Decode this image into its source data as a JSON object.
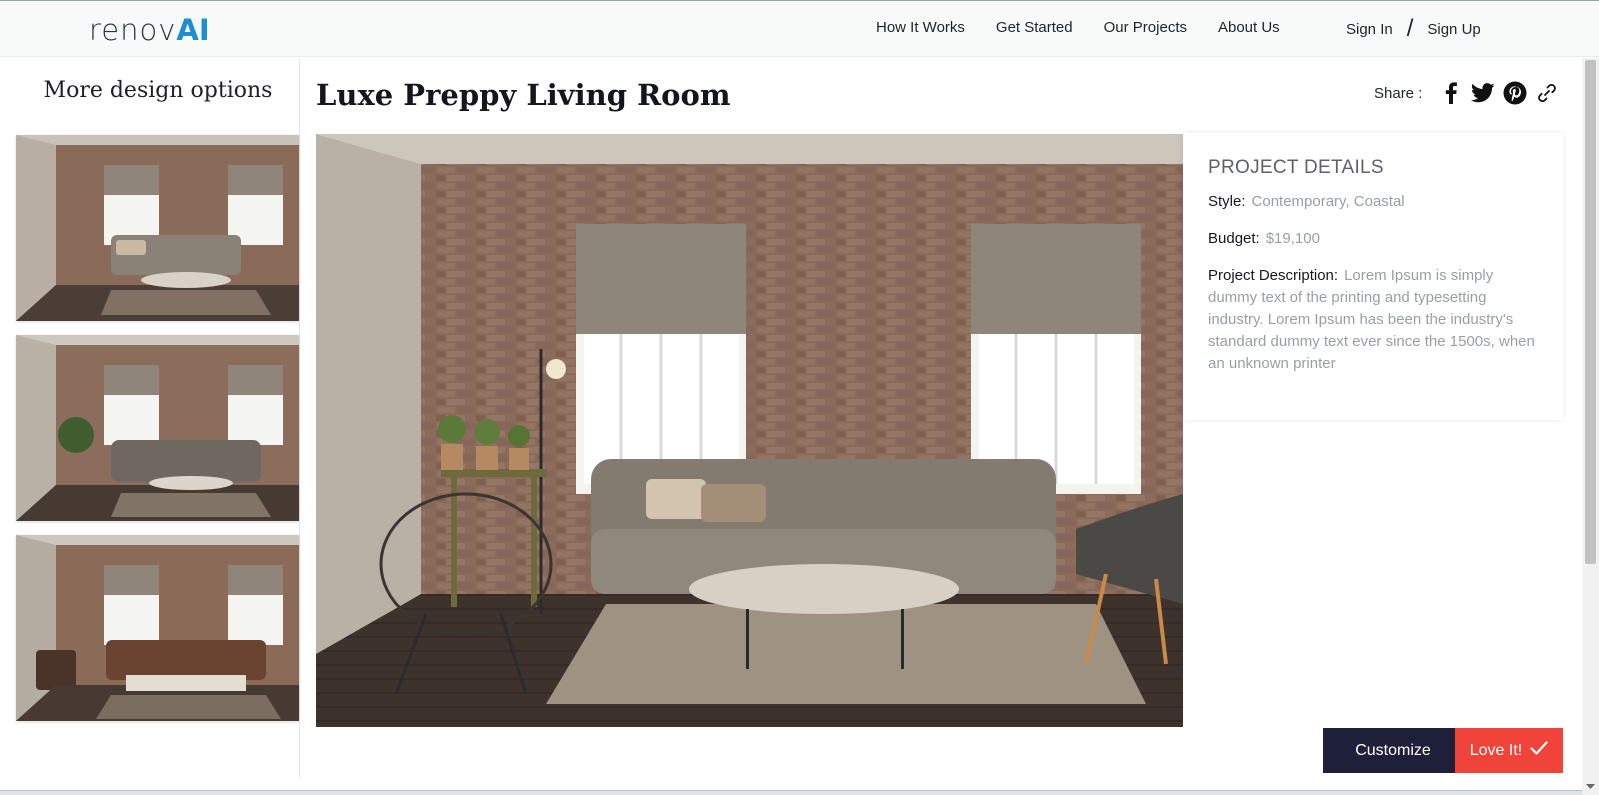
{
  "header": {
    "logo": {
      "main": "renov",
      "accent": "AI"
    },
    "nav": [
      "How It Works",
      "Get Started",
      "Our Projects",
      "About Us"
    ],
    "auth": {
      "signin": "Sign In",
      "separator": "/",
      "signup": "Sign Up"
    }
  },
  "sidebar": {
    "title": "More design options",
    "thumbnails": [
      "design-option-1",
      "design-option-2",
      "design-option-3"
    ]
  },
  "main": {
    "title": "Luxe Preppy Living Room",
    "share": {
      "label": "Share :",
      "icons": [
        "facebook-icon",
        "twitter-icon",
        "pinterest-icon",
        "link-icon"
      ]
    }
  },
  "details": {
    "heading": "PROJECT DETAILS",
    "style_label": "Style:",
    "style_value": "Contemporary, Coastal",
    "budget_label": "Budget:",
    "budget_value": "$19,100",
    "description_label": "Project Description:",
    "description_value": "Lorem Ipsum is simply dummy text of the printing and typesetting industry. Lorem Ipsum has been the industry's standard dummy text ever since the 1500s, when an unknown printer"
  },
  "actions": {
    "customize": "Customize",
    "love": "Love It!"
  },
  "colors": {
    "accent_blue": "#1d8fd0",
    "customize_bg": "#1e1f38",
    "love_bg": "#f0433a"
  }
}
